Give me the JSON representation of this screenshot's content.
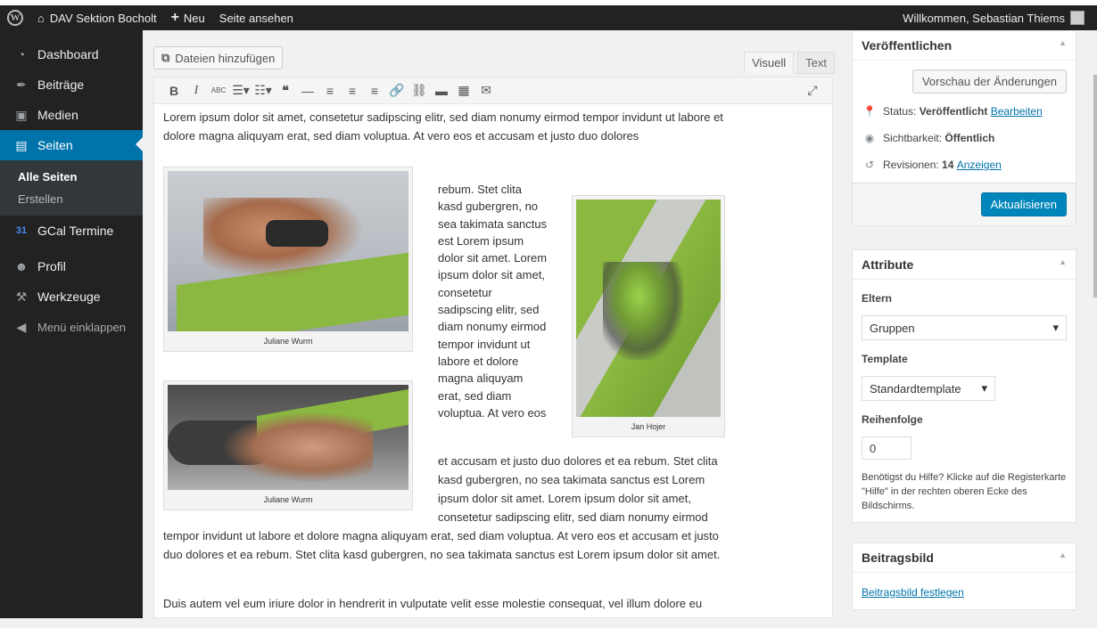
{
  "adminbar": {
    "site_name": "DAV Sektion Bocholt",
    "new_label": "Neu",
    "view_label": "Seite ansehen",
    "welcome": "Willkommen, Sebastian Thiems"
  },
  "sidebar": {
    "items": [
      {
        "label": "Dashboard",
        "icon": "dashboard-icon"
      },
      {
        "label": "Beiträge",
        "icon": "pin-icon"
      },
      {
        "label": "Medien",
        "icon": "media-icon"
      },
      {
        "label": "Seiten",
        "icon": "pages-icon"
      },
      {
        "label": "GCal Termine",
        "icon": "calendar-icon"
      },
      {
        "label": "Profil",
        "icon": "user-icon"
      },
      {
        "label": "Werkzeuge",
        "icon": "wrench-icon"
      },
      {
        "label": "Menü einklappen",
        "icon": "collapse-icon"
      }
    ],
    "submenu": [
      "Alle Seiten",
      "Erstellen"
    ]
  },
  "editor": {
    "media_button": "Dateien hinzufügen",
    "tab_visual": "Visuell",
    "tab_text": "Text",
    "para1": "Lorem ipsum dolor sit amet, consetetur sadipscing elitr, sed diam nonumy eirmod tempor invidunt ut labore et dolore magna aliquyam erat, sed diam voluptua. At vero eos et accusam et justo duo dolores",
    "flow_narrow": "rebum. Stet clita kasd gubergren, no sea takimata sanctus est Lorem ipsum dolor sit amet. Lorem ipsum dolor sit amet, consetetur sadipscing elitr, sed diam nonumy eirmod tempor invidunt ut labore et dolore magna aliquyam erat, sed diam voluptua. At vero eos",
    "flow_mid": "et accusam et justo duo dolores et ea rebum. Stet clita kasd gubergren, no sea takimata sanctus est Lorem ipsum dolor sit amet. Lorem ipsum dolor sit amet, consetetur sadipscing elitr, sed diam nonumy eirmod",
    "flow_full": "tempor invidunt ut labore et dolore magna aliquyam erat, sed diam voluptua. At vero eos et accusam et justo duo dolores et ea rebum. Stet clita kasd gubergren, no sea takimata sanctus est Lorem ipsum dolor sit amet.",
    "para2": "Duis autem vel eum iriure dolor in hendrerit in vulputate velit esse molestie consequat, vel illum dolore eu",
    "caption1": "Juliane Wurm",
    "caption2": "Juliane Wurm",
    "caption3": "Jan Hojer"
  },
  "publish": {
    "title": "Veröffentlichen",
    "preview_button": "Vorschau der Änderungen",
    "status_label": "Status:",
    "status_value": "Veröffentlicht",
    "status_edit": "Bearbeiten",
    "visibility_label": "Sichtbarkeit:",
    "visibility_value": "Öffentlich",
    "revisions_label": "Revisionen:",
    "revisions_value": "14",
    "revisions_link": "Anzeigen",
    "update_button": "Aktualisieren"
  },
  "attributes": {
    "title": "Attribute",
    "parent_label": "Eltern",
    "parent_value": "Gruppen",
    "template_label": "Template",
    "template_value": "Standardtemplate",
    "order_label": "Reihenfolge",
    "order_value": "0",
    "help_text": "Benötigst du Hilfe? Klicke auf die Registerkarte \"Hilfe\" in der rechten oberen Ecke des Bildschirms."
  },
  "featured": {
    "title": "Beitragsbild",
    "link": "Beitragsbild festlegen"
  },
  "colors": {
    "admin_dark": "#222222",
    "accent": "#0073aa",
    "climbing_green": "#8ab840"
  }
}
